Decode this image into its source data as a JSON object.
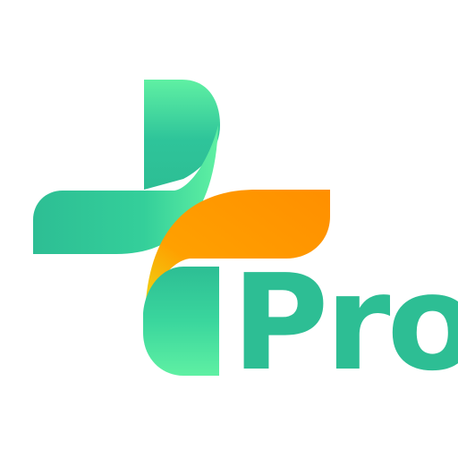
{
  "logo": {
    "wordmark": "Pro",
    "icon": "medical-cross-icon",
    "colors": {
      "wordmark": "#2dbe94",
      "green_dark": "#2dbe94",
      "green_light": "#5ff0a3",
      "orange": "#ff9100",
      "yellow": "#e9e21a",
      "background": "#ffffff"
    }
  }
}
